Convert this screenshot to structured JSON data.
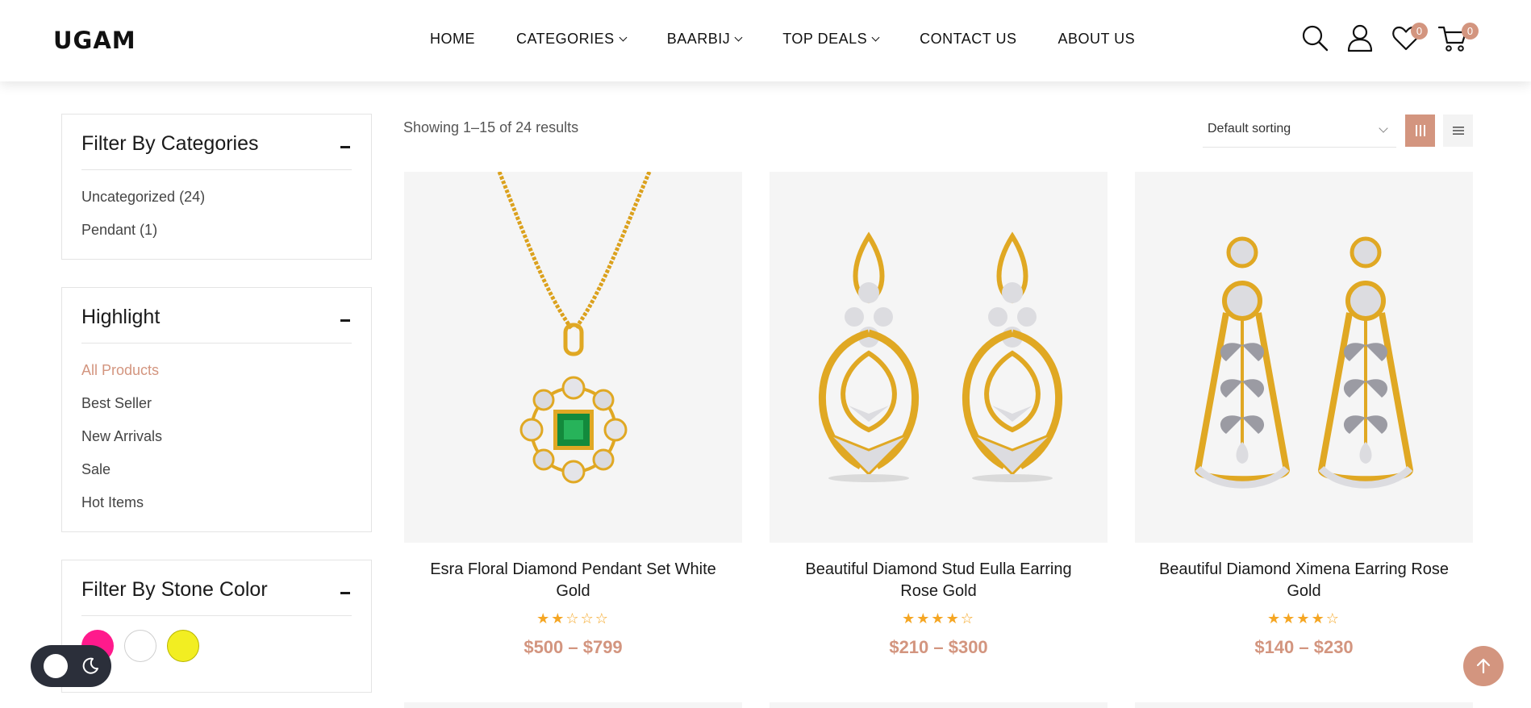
{
  "header": {
    "logo": "UGAM",
    "nav": [
      {
        "label": "HOME",
        "has_dropdown": false
      },
      {
        "label": "CATEGORIES",
        "has_dropdown": true
      },
      {
        "label": "BAARBIJ",
        "has_dropdown": true
      },
      {
        "label": "TOP DEALS",
        "has_dropdown": true
      },
      {
        "label": "CONTACT US",
        "has_dropdown": false
      },
      {
        "label": "ABOUT US",
        "has_dropdown": false
      }
    ],
    "icons": [
      "search-icon",
      "user-icon",
      "heart-icon",
      "cart-icon"
    ],
    "wishlist_count": "0",
    "cart_count": "0"
  },
  "sidebar": {
    "categories": {
      "title": "Filter By Categories",
      "items": [
        "Uncategorized (24)",
        "Pendant (1)"
      ]
    },
    "highlight": {
      "title": "Highlight",
      "items": [
        "All Products",
        "Best Seller",
        "New Arrivals",
        "Sale",
        "Hot Items"
      ],
      "active": "All Products"
    },
    "stone_color": {
      "title": "Filter By Stone Color",
      "colors": [
        "#ff1a8c",
        "#ffffff",
        "#f2ee22"
      ]
    }
  },
  "toolbar": {
    "result_count": "Showing 1–15 of 24 results",
    "sort_selected": "Default sorting",
    "view_modes": [
      "grid-view-icon",
      "list-view-icon"
    ],
    "active_view": "grid-view-icon"
  },
  "products": [
    {
      "title": "Esra Floral Diamond Pendant Set White Gold",
      "rating": 2,
      "price": "$500 – $799",
      "image": "pendant-image"
    },
    {
      "title": "Beautiful Diamond Stud Eulla Earring Rose Gold",
      "rating": 4,
      "price": "$210 – $300",
      "image": "earring-image"
    },
    {
      "title": "Beautiful Diamond Ximena Earring Rose Gold",
      "rating": 4,
      "price": "$140 – $230",
      "image": "drop-earring-image"
    }
  ],
  "colors": {
    "accent": "#d3957f",
    "star": "#f5a623",
    "card_bg": "#f5f5f5",
    "toggle_bg": "#2b2f3a"
  },
  "floating": {
    "dark_mode_toggle": "moon-icon",
    "back_to_top": "arrow-up-icon"
  }
}
